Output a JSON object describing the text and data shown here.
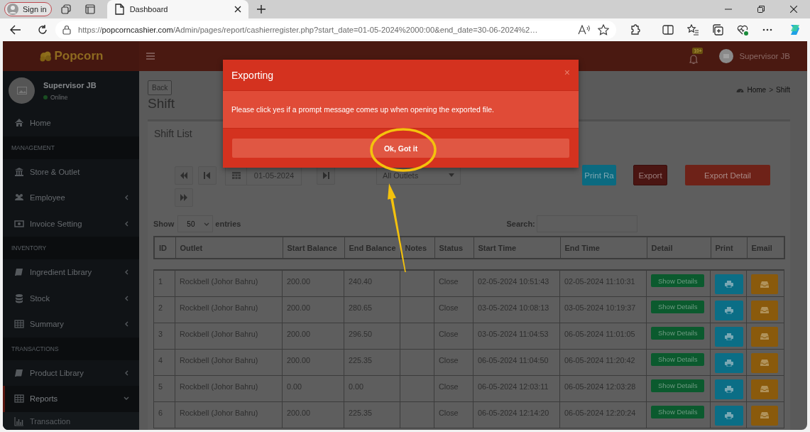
{
  "browser": {
    "profile": "Sign in",
    "tabs": [
      {
        "title": "Dashboard",
        "selected": true
      }
    ],
    "url": "https://**popcorncashier.com**/Admin/pages/report/cashierregister.php?start_date=01-05-2024%2000:00&end_date=30-06-2024%2…"
  },
  "header": {
    "brand": "Popcorn",
    "notification_count": "10+",
    "user": "Supervisor JB"
  },
  "sidebar": {
    "user": "Supervisor JB",
    "status": "Online",
    "items": [
      {
        "kind": "link",
        "label": "Home",
        "selected": false
      },
      {
        "kind": "header",
        "label": "MANAGEMENT"
      },
      {
        "kind": "link",
        "label": "Store & Outlet",
        "selected": false
      },
      {
        "kind": "menu",
        "label": "Employee",
        "selected": false,
        "expanded": false
      },
      {
        "kind": "menu",
        "label": "Invoice Setting",
        "selected": false,
        "expanded": false
      },
      {
        "kind": "header",
        "label": "INVENTORY"
      },
      {
        "kind": "menu",
        "label": "Ingredient Library",
        "selected": false,
        "expanded": false
      },
      {
        "kind": "menu",
        "label": "Stock",
        "selected": false,
        "expanded": false
      },
      {
        "kind": "menu",
        "label": "Summary",
        "selected": false,
        "expanded": false
      },
      {
        "kind": "header",
        "label": "TRANSACTIONS"
      },
      {
        "kind": "menu",
        "label": "Product Library",
        "selected": false,
        "expanded": false
      },
      {
        "kind": "menu",
        "label": "Reports",
        "selected": true,
        "expanded": true
      },
      {
        "kind": "sub",
        "label": "Transaction",
        "selected": false
      }
    ]
  },
  "page": {
    "back": "Back",
    "title": "Shift",
    "breadcrumb": [
      "Home",
      "Shift"
    ],
    "breadcrumb_separator": ">",
    "box_title": "Shift List",
    "date": "01-05-2024",
    "outlet": "All Outlets",
    "actions": [
      {
        "kind": "print",
        "label": "Print Ra"
      },
      {
        "kind": "export",
        "label": "Export"
      },
      {
        "kind": "detail",
        "label": "Export Detail"
      }
    ],
    "length": {
      "before": "Show",
      "value": "50",
      "after": "entries"
    },
    "search": {
      "label": "Search:"
    },
    "table": {
      "columns": [
        "ID",
        "Outlet",
        "Start Balance",
        "End Balance",
        "Notes",
        "Status",
        "Start Time",
        "End Time",
        "Detail",
        "Print",
        "Email"
      ],
      "rows": [
        {
          "id": "1",
          "outlet": "Rockbell (Johor Bahru)",
          "start_balance": "200.00",
          "end_balance": "240.40",
          "status": "Close",
          "start_time": "02-05-2024 10:51:43",
          "end_time": "02-05-2024 11:10:31",
          "detail": "Show Details"
        },
        {
          "id": "2",
          "outlet": "Rockbell (Johor Bahru)",
          "start_balance": "200.00",
          "end_balance": "280.65",
          "status": "Close",
          "start_time": "03-05-2024 10:08:13",
          "end_time": "03-05-2024 10:19:37",
          "detail": "Show Details"
        },
        {
          "id": "3",
          "outlet": "Rockbell (Johor Bahru)",
          "start_balance": "200.00",
          "end_balance": "296.50",
          "status": "Close",
          "start_time": "03-05-2024 11:04:53",
          "end_time": "06-05-2024 11:01:05",
          "detail": "Show Details"
        },
        {
          "id": "4",
          "outlet": "Rockbell (Johor Bahru)",
          "start_balance": "200.00",
          "end_balance": "225.35",
          "status": "Close",
          "start_time": "06-05-2024 11:04:50",
          "end_time": "06-05-2024 11:20:42",
          "detail": "Show Details"
        },
        {
          "id": "5",
          "outlet": "Rockbell (Johor Bahru)",
          "start_balance": "0.00",
          "end_balance": "0.00",
          "status": "Close",
          "start_time": "06-05-2024 12:03:11",
          "end_time": "06-05-2024 12:03:28",
          "detail": "Show Details"
        },
        {
          "id": "6",
          "outlet": "Rockbell (Johor Bahru)",
          "start_balance": "200.00",
          "end_balance": "225.35",
          "status": "Close",
          "start_time": "06-05-2024 12:14:20",
          "end_time": "06-05-2024 12:20:24",
          "detail": "Show Details"
        }
      ]
    }
  },
  "modal": {
    "title": "Exporting",
    "close": "×",
    "message": "Please click yes if a prompt message comes up when opening the exported file.",
    "button": "Ok, Got it"
  }
}
